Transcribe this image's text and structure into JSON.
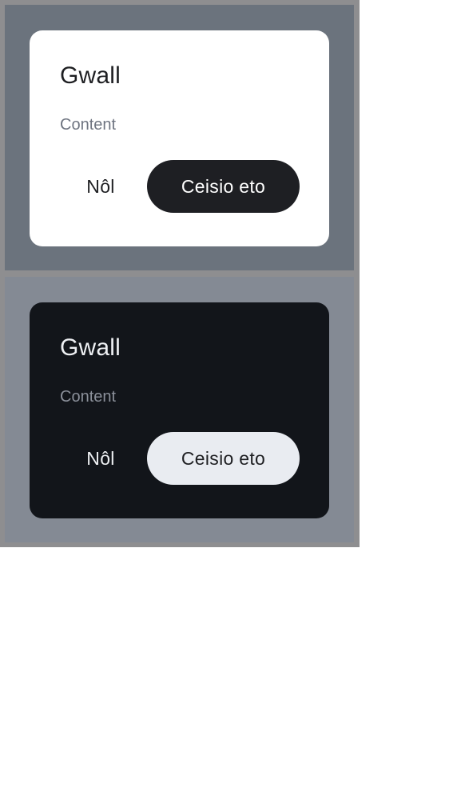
{
  "light_dialog": {
    "title": "Gwall",
    "content": "Content",
    "cancel_label": "Nôl",
    "confirm_label": "Ceisio eto"
  },
  "dark_dialog": {
    "title": "Gwall",
    "content": "Content",
    "cancel_label": "Nôl",
    "confirm_label": "Ceisio eto"
  },
  "colors": {
    "light_backdrop": "#6b737d",
    "dark_backdrop": "#848a94",
    "light_surface": "#ffffff",
    "dark_surface": "#12151a",
    "light_primary_button": "#1e1f23",
    "dark_primary_button": "#e9ecf1"
  }
}
